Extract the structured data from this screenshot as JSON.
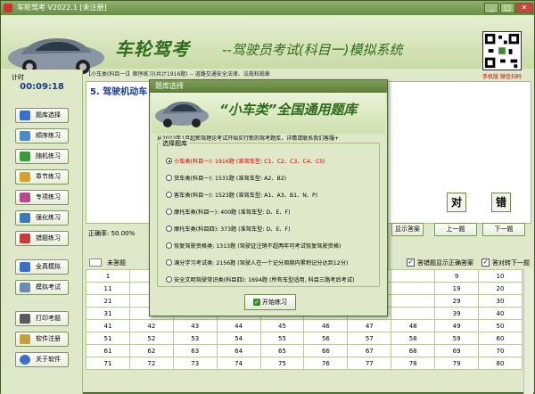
{
  "window": {
    "title": "车轮驾考 V2022.1 [未注册]"
  },
  "banner": {
    "brand": "车轮驾考",
    "subtitle": "--驾驶员考试(科目一)模拟系统",
    "qr_label": "手机版 微信扫码"
  },
  "infobar": "【小车类(科目一)】顺序练习(共计1916题) -- 道路交通安全法律、法规和规章",
  "timer": {
    "label": "计时",
    "value": "00:09:18"
  },
  "sidebar": [
    {
      "label": "题库选择",
      "icon_color": "#3a6fc7"
    },
    {
      "label": "顺序练习",
      "icon_color": "#4a8ad0"
    },
    {
      "label": "随机练习",
      "icon_color": "#3a9a3a"
    },
    {
      "label": "章节练习",
      "icon_color": "#d9a12a"
    },
    {
      "label": "专项练习",
      "icon_color": "#b84a8a"
    },
    {
      "label": "强化练习",
      "icon_color": "#3a7ab8"
    },
    {
      "label": "错题练习",
      "icon_color": "#c83a3a"
    },
    {
      "label": "全真模拟",
      "icon_color": "#3a6fc7"
    },
    {
      "label": "模拟考试",
      "icon_color": "#6a8ab0"
    },
    {
      "label": "打印考题",
      "icon_color": "#5a5a5a"
    },
    {
      "label": "软件注册",
      "icon_color": "#c8a03a"
    },
    {
      "label": "关于软件",
      "icon_color": "#3a6fc7"
    }
  ],
  "question": {
    "text": "5. 驾驶机动车"
  },
  "buttons": {
    "right": "对",
    "wrong": "错",
    "show_answer": "显示答案",
    "prev": "上一题",
    "next": "下一题"
  },
  "progress": {
    "label": "正确率: 50.00%"
  },
  "status": {
    "unanswered": "未答题",
    "opt1": "答错题显示正确答案",
    "opt2": "答对转下一题"
  },
  "grid_rows": [
    [
      "1",
      "",
      "",
      "",
      "",
      "",
      "",
      "",
      "9",
      "10"
    ],
    [
      "11",
      "",
      "",
      "",
      "",
      "",
      "",
      "",
      "19",
      "20"
    ],
    [
      "21",
      "",
      "",
      "",
      "",
      "",
      "",
      "",
      "29",
      "30"
    ],
    [
      "31",
      "",
      "",
      "",
      "",
      "",
      "",
      "",
      "39",
      "40"
    ],
    [
      "41",
      "42",
      "43",
      "44",
      "45",
      "46",
      "47",
      "48",
      "49",
      "50"
    ],
    [
      "51",
      "52",
      "53",
      "54",
      "55",
      "56",
      "57",
      "58",
      "59",
      "60"
    ],
    [
      "61",
      "62",
      "63",
      "64",
      "65",
      "66",
      "67",
      "68",
      "69",
      "70"
    ],
    [
      "71",
      "72",
      "73",
      "74",
      "75",
      "76",
      "77",
      "78",
      "79",
      "80"
    ]
  ],
  "dialog": {
    "title": "题库选择",
    "headline": "“小车类”全国通用题库",
    "note": "从2022年1月起新驾理论考试开始实行新的驾考题库，详情请联系我们客服+",
    "group_title": "选择题库",
    "options": [
      "小车类(科目一): 1916题 (准驾车型: C1、C2、C3、C4、C5)",
      "货车类(科目一): 1531题 (准驾车型: A2、B2)",
      "客车类(科目一): 1523题 (准驾车型: A1、A3、B1、N、P)",
      "摩托车类(科目一): 400题 (准驾车型: D、E、F)",
      "摩托车类(科目四): 373题 (准驾车型: D、E、F)",
      "恢复驾驶资格类: 1313题 (驾驶证注销不超两年可考试恢复驾驶资格)",
      "满分学习考试类: 2156题 (驾驶人在一个记分周期内累积记分达到12分)",
      "安全文明驾驶常识类(科目四): 1694题 (所有车型适用, 科目三路考后考试)"
    ],
    "start": "开始练习"
  }
}
